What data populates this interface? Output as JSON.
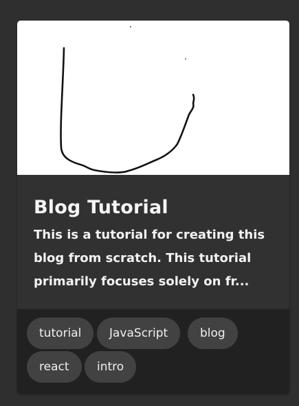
{
  "post": {
    "title": "Blog Tutorial",
    "excerpt": "This is a tutorial for creating this blog from scratch. This tutorial primarily focuses solely on fr...",
    "tags": [
      "tutorial",
      "JavaScript",
      "blog",
      "react",
      "intro"
    ]
  }
}
